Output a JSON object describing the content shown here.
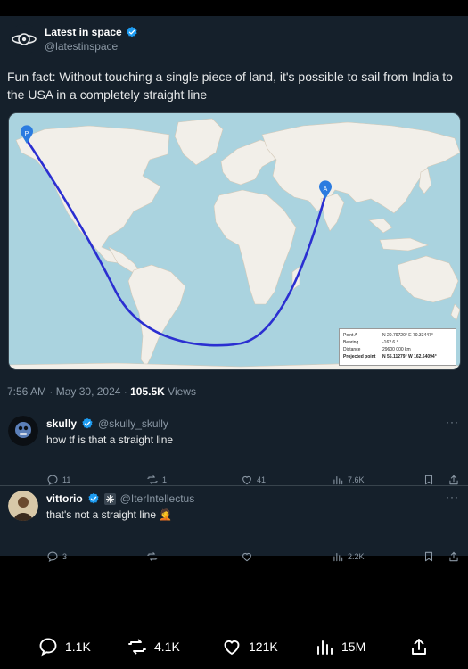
{
  "post": {
    "author_name": "Latest in space",
    "author_handle": "@latestinspace",
    "text": "Fun fact: Without touching a single piece of land, it's possible to sail from India to the USA in a completely straight line",
    "time": "7:56 AM",
    "date": "May 30, 2024",
    "views_count": "105.5K",
    "views_label": "Views",
    "separator": "·"
  },
  "map": {
    "pin_start": "P",
    "pin_end": "A",
    "route_color": "#2b2fd1",
    "info": {
      "point_a_label": "Point A",
      "point_a_value": "N 20.79720° E 70.33447°",
      "bearing_label": "Bearing",
      "bearing_value": "-162.6 °",
      "distance_label": "Distance",
      "distance_value": "29600 000 km",
      "projected_label": "Projected point",
      "projected_value": "N 55.11279° W 162.64094°"
    }
  },
  "replies": [
    {
      "name": "skully",
      "handle": "@skully_skully",
      "text": "how tf is that a straight line",
      "more": "···",
      "replies": "11",
      "reposts": "1",
      "likes": "41",
      "views": "7.6K"
    },
    {
      "name": "vittorio",
      "handle": "@IterIntellectus",
      "text": "that's not a straight line 🤦",
      "more": "···",
      "replies": "3",
      "reposts": "",
      "likes": "",
      "views": "2.2K"
    }
  ],
  "bottom": {
    "replies": "1.1K",
    "reposts": "4.1K",
    "likes": "121K",
    "views": "15M"
  },
  "colors": {
    "background": "#15202b",
    "verified": "#1d9bf0",
    "muted": "#8b98a5"
  },
  "icons": [
    "galaxy-logo-icon",
    "verified-icon",
    "reply-icon",
    "repost-icon",
    "like-icon",
    "views-icon",
    "bookmark-icon",
    "share-icon"
  ]
}
